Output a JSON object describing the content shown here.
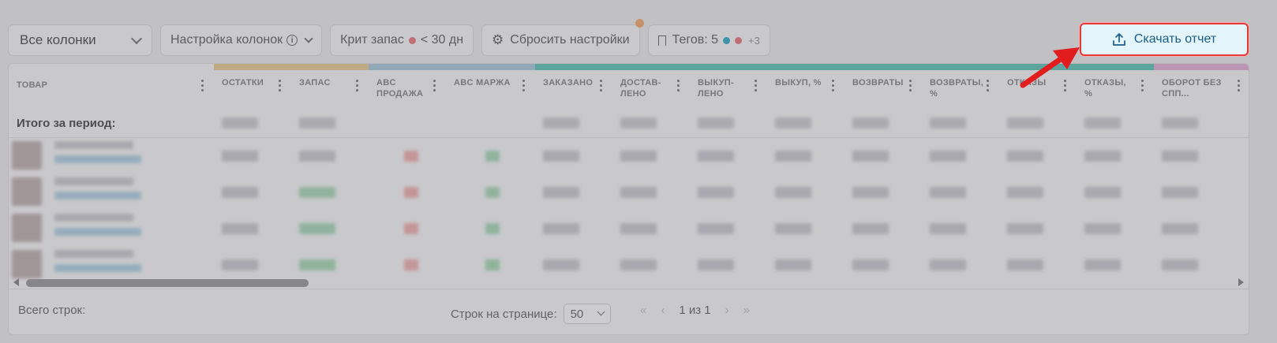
{
  "toolbar": {
    "columns_select": "Все колонки",
    "columns_settings": "Настройка колонок",
    "crit_stock_label": "Крит запас",
    "crit_stock_value": "< 30 дн",
    "reset_settings": "Сбросить настройки",
    "tags_label": "Тегов: 5",
    "tags_more": "+3",
    "download_report": "Скачать отчет"
  },
  "colors": {
    "accent_red": "#e53935",
    "download_bg": "#e3f4fb",
    "bar_yellow": "#e7c98a",
    "bar_blue": "#9fc5dc",
    "bar_teal": "#4bbfb2",
    "bar_pink": "#e6a9d6",
    "dot_red": "#e86a6f",
    "dot_blue": "#1aa2c6"
  },
  "table": {
    "columns": [
      {
        "label": "Товар"
      },
      {
        "label": "Остатки"
      },
      {
        "label": "Запас"
      },
      {
        "label": "ABC продажа"
      },
      {
        "label": "ABC маржа"
      },
      {
        "label": "Заказано"
      },
      {
        "label": "Достав-лено"
      },
      {
        "label": "Выкуп-лено"
      },
      {
        "label": "Выкуп, %"
      },
      {
        "label": "Возвраты"
      },
      {
        "label": "Возвраты, %"
      },
      {
        "label": "Отказы"
      },
      {
        "label": "Отказы, %"
      },
      {
        "label": "Оборот без СПП..."
      }
    ],
    "total_label": "Итого за период:"
  },
  "footer": {
    "total_rows_label": "Всего строк:",
    "per_page_label": "Строк на странице:",
    "per_page_value": "50",
    "page_info": "1 из 1"
  }
}
